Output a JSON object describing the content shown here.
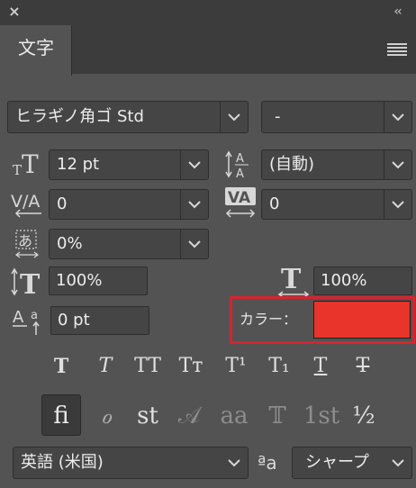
{
  "panel": {
    "tab_label": "文字",
    "close_glyph": "×",
    "collapse_glyph": "‹‹"
  },
  "font": {
    "family": "ヒラギノ角ゴ Std",
    "style": "-"
  },
  "metrics": {
    "size": "12 pt",
    "leading": "(自動)",
    "kerning": "0",
    "tracking": "0",
    "tsume": "0%",
    "vertical_scale": "100%",
    "horizontal_scale": "100%",
    "baseline_shift": "0 pt"
  },
  "color": {
    "label": "カラー：",
    "swatch": "#e8342a",
    "highlight": "#d6242f"
  },
  "type_styles": [
    "T",
    "T",
    "TT",
    "Tт",
    "T¹",
    "T₁",
    "T",
    "T"
  ],
  "opentype": [
    "ﬁ",
    "ℴ",
    "st",
    "𝒜",
    "aa",
    "𝕋",
    "1st",
    "½"
  ],
  "language": "英語 (米国)",
  "antialias_icon_text": "ªa",
  "antialias": "シャープ"
}
